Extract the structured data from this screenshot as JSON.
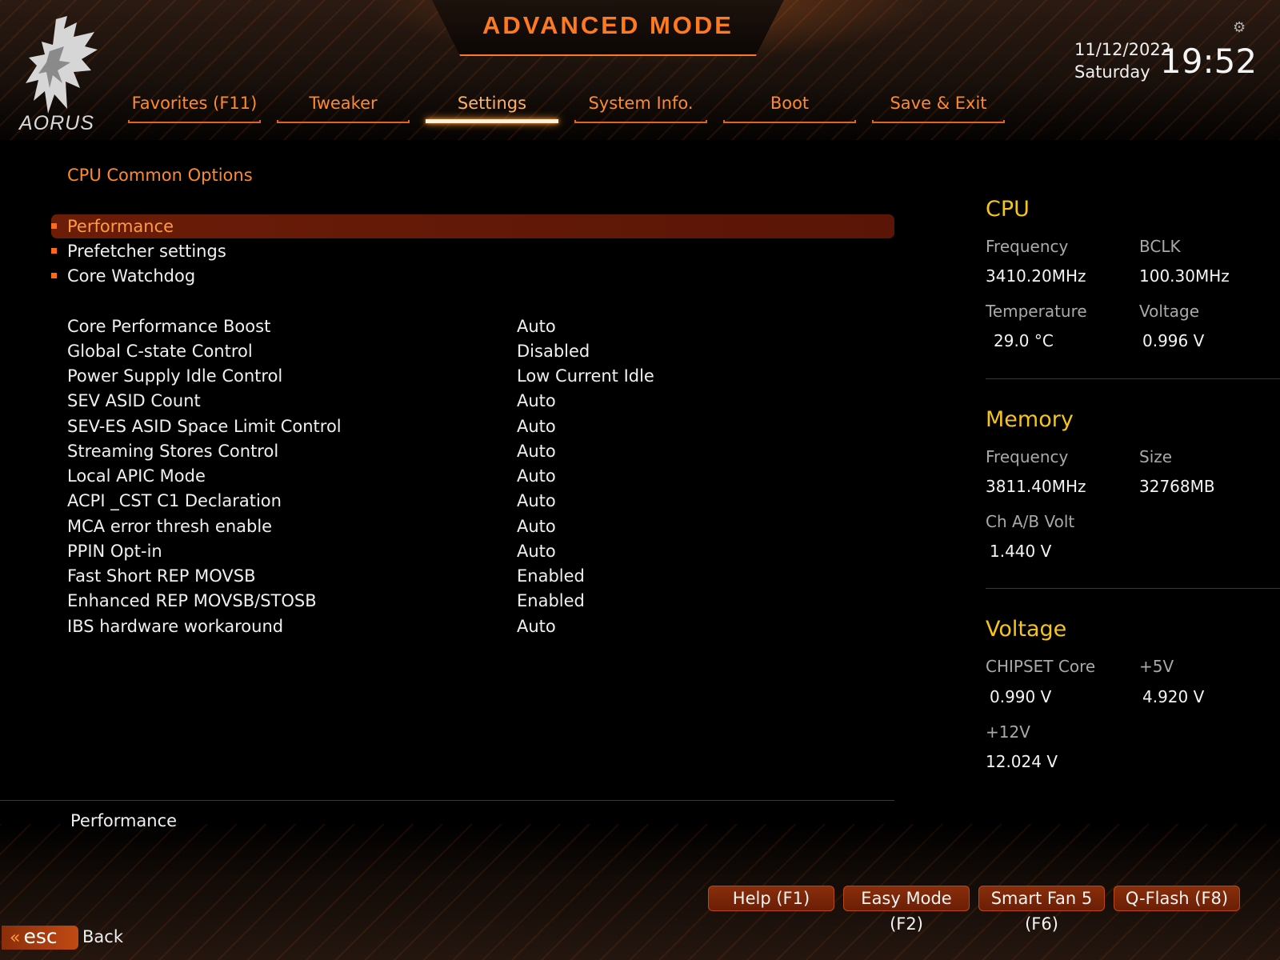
{
  "header": {
    "mode_title": "ADVANCED MODE",
    "logo_text": "AORUS",
    "date": "11/12/2022",
    "day": "Saturday",
    "time": "19:52"
  },
  "tabs": [
    {
      "label": "Favorites (F11)"
    },
    {
      "label": "Tweaker"
    },
    {
      "label": "Settings",
      "active": true
    },
    {
      "label": "System Info."
    },
    {
      "label": "Boot"
    },
    {
      "label": "Save & Exit"
    }
  ],
  "main": {
    "section_title": "CPU Common Options",
    "submenus": [
      {
        "label": "Performance",
        "selected": true
      },
      {
        "label": "Prefetcher settings"
      },
      {
        "label": "Core Watchdog"
      }
    ],
    "options": [
      {
        "label": "Core Performance Boost",
        "value": "Auto"
      },
      {
        "label": "Global C-state Control",
        "value": "Disabled"
      },
      {
        "label": "Power Supply Idle Control",
        "value": "Low Current Idle"
      },
      {
        "label": "SEV ASID Count",
        "value": "Auto"
      },
      {
        "label": "SEV-ES ASID Space Limit Control",
        "value": "Auto"
      },
      {
        "label": "Streaming Stores Control",
        "value": "Auto"
      },
      {
        "label": "Local APIC Mode",
        "value": "Auto"
      },
      {
        "label": "ACPI _CST C1 Declaration",
        "value": "Auto"
      },
      {
        "label": "MCA error thresh enable",
        "value": "Auto"
      },
      {
        "label": "PPIN Opt-in",
        "value": "Auto"
      },
      {
        "label": "Fast Short REP MOVSB",
        "value": "Enabled"
      },
      {
        "label": "Enhanced REP MOVSB/STOSB",
        "value": "Enabled"
      },
      {
        "label": "IBS hardware workaround",
        "value": "Auto"
      }
    ],
    "help_text": "Performance"
  },
  "panel": {
    "cpu": {
      "title": "CPU",
      "frequency_label": "Frequency",
      "frequency": "3410.20MHz",
      "bclk_label": "BCLK",
      "bclk": "100.30MHz",
      "temperature_label": "Temperature",
      "temperature": "29.0 °C",
      "voltage_label": "Voltage",
      "voltage": "0.996 V"
    },
    "memory": {
      "title": "Memory",
      "frequency_label": "Frequency",
      "frequency": "3811.40MHz",
      "size_label": "Size",
      "size": "32768MB",
      "volt_label": "Ch A/B Volt",
      "volt": "1.440 V"
    },
    "voltage": {
      "title": "Voltage",
      "chipset_label": "CHIPSET Core",
      "chipset": "0.990 V",
      "v5_label": "+5V",
      "v5": "4.920 V",
      "v12_label": "+12V",
      "v12": "12.024 V"
    }
  },
  "footer": {
    "buttons": [
      {
        "label": "Help (F1)"
      },
      {
        "label": "Easy Mode (F2)"
      },
      {
        "label": "Smart Fan 5 (F6)"
      },
      {
        "label": "Q-Flash (F8)"
      }
    ],
    "esc_label": "esc",
    "back_label": "Back"
  },
  "colors": {
    "accent": "#ff7a1e",
    "selected_bar": "#6b1d08",
    "panel_heading": "#f5c518"
  }
}
